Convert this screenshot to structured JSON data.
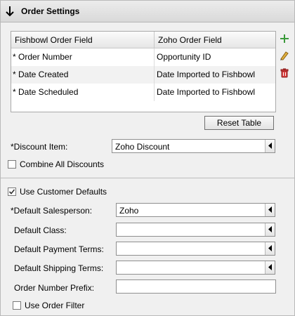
{
  "header": {
    "title": "Order Settings"
  },
  "table": {
    "columns": [
      "Fishbowl Order Field",
      "Zoho Order Field"
    ],
    "rows": [
      {
        "fishbowl": "* Order Number",
        "zoho": "Opportunity ID"
      },
      {
        "fishbowl": "* Date Created",
        "zoho": "Date Imported to Fishbowl"
      },
      {
        "fishbowl": "* Date Scheduled",
        "zoho": "Date Imported to Fishbowl"
      }
    ]
  },
  "actions": {
    "reset_label": "Reset Table"
  },
  "discount": {
    "label": "*Discount Item:",
    "value": "Zoho Discount",
    "combine_label": "Combine All Discounts",
    "combine_checked": false
  },
  "defaults": {
    "use_label": "Use Customer Defaults",
    "use_checked": true,
    "salesperson_label": "*Default Salesperson:",
    "salesperson_value": "Zoho",
    "class_label": "Default Class:",
    "class_value": "",
    "payment_label": "Default Payment Terms:",
    "payment_value": "",
    "shipping_label": "Default Shipping Terms:",
    "shipping_value": "",
    "prefix_label": "Order Number Prefix:",
    "prefix_value": "",
    "filter_label": "Use Order Filter",
    "filter_checked": false
  },
  "icons": {
    "add": "plus-icon",
    "edit": "pencil-icon",
    "delete": "trash-icon",
    "collapse": "arrow-down-icon"
  },
  "colors": {
    "add": "#3a9a3a",
    "edit": "#c8961e",
    "delete": "#c83232"
  }
}
